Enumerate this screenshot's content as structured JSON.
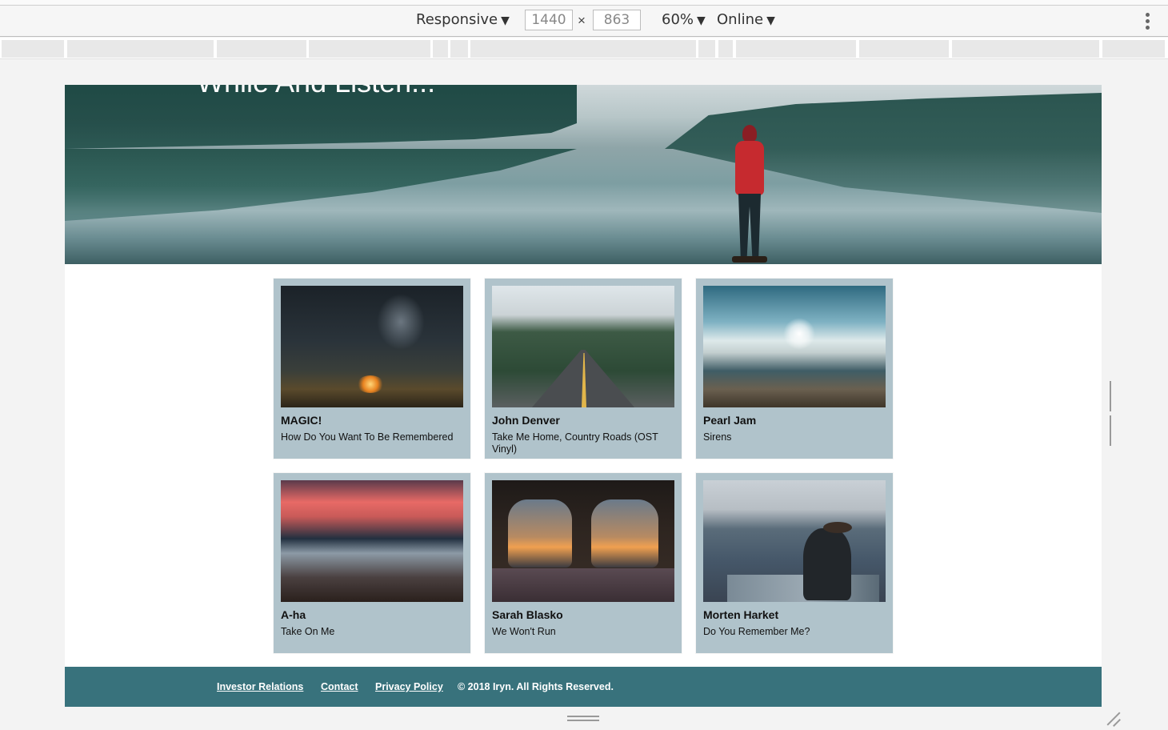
{
  "devtools": {
    "device_mode": "Responsive",
    "width": "1440",
    "height": "863",
    "times": "×",
    "zoom": "60%",
    "network": "Online",
    "caret": "▼"
  },
  "page": {
    "hero_title": "While And Listen...",
    "cards": [
      {
        "artist": "MAGIC!",
        "song": "How Do You Want To Be Remembered"
      },
      {
        "artist": "John Denver",
        "song": "Take Me Home, Country Roads (OST Vinyl)"
      },
      {
        "artist": "Pearl Jam",
        "song": "Sirens"
      },
      {
        "artist": "A-ha",
        "song": "Take On Me"
      },
      {
        "artist": "Sarah Blasko",
        "song": "We Won't Run"
      },
      {
        "artist": "Morten Harket",
        "song": "Do You Remember Me?"
      }
    ],
    "footer": {
      "links": [
        "Investor Relations",
        "Contact",
        "Privacy Policy"
      ],
      "copyright": "© 2018 Iryn. All Rights Reserved."
    }
  },
  "colors": {
    "card_bg": "#b0c3cb",
    "footer_bg": "#38727c",
    "jacket_red": "#c62a2f"
  },
  "icons": {
    "more_menu": "kebab-vertical-icon",
    "side_resize": "vertical-resize-handle-icon",
    "bottom_resize": "horizontal-resize-handle-icon",
    "corner_resize": "corner-resize-icon"
  }
}
